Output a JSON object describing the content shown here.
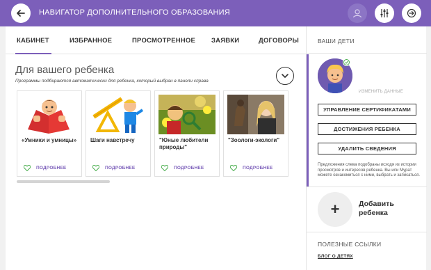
{
  "header": {
    "title": "НАВИГАТОР ДОПОЛНИТЕЛЬНОГО ОБРАЗОВАНИЯ",
    "back_icon": "arrow-left-icon",
    "user_icon": "user-icon",
    "filter_icon": "sliders-icon",
    "exit_icon": "exit-icon"
  },
  "tabs": [
    {
      "label": "КАБИНЕТ",
      "active": true
    },
    {
      "label": "ИЗБРАННОЕ"
    },
    {
      "label": "ПРОСМОТРЕННОЕ"
    },
    {
      "label": "ЗАЯВКИ"
    },
    {
      "label": "ДОГОВОРЫ"
    }
  ],
  "section": {
    "title": "Для вашего ребенка",
    "subtitle": "Программы подбираются автоматически для ребенка, который выбран в панели справа"
  },
  "cards": [
    {
      "title": "«Умники и умницы»",
      "more": "ПОДРОБНЕЕ"
    },
    {
      "title": "Шаги навстречу",
      "more": "ПОДРОБНЕЕ"
    },
    {
      "title": "\"Юные любители природы\"",
      "more": "ПОДРОБНЕЕ"
    },
    {
      "title": "\"Зоологи-экологи\"",
      "more": "ПОДРОБНЕЕ"
    }
  ],
  "sidebar": {
    "heading": "ВАШИ ДЕТИ",
    "change_link": "ИЗМЕНИТЬ ДАННЫЕ",
    "buttons": {
      "certificates": "УПРАВЛЕНИЕ СЕРТИФИКАТАМИ",
      "achievements": "ДОСТИЖЕНИЯ РЕБЕНКА",
      "delete": "УДАЛИТЬ СВЕДЕНИЯ"
    },
    "note": "Предложения слева подобраны исходя из истории просмотров и интересов ребенка. Вы или Мурат можете ознакомиться с ними, выбрать и записаться.",
    "add_child": {
      "plus": "+",
      "label": "Добавить ребенка"
    },
    "links_heading": "ПОЛЕЗНЫЕ ССЫЛКИ",
    "blog_link": "БЛОГ О ДЕТЯХ"
  },
  "colors": {
    "accent": "#7c5fba",
    "like": "#4caf50"
  }
}
